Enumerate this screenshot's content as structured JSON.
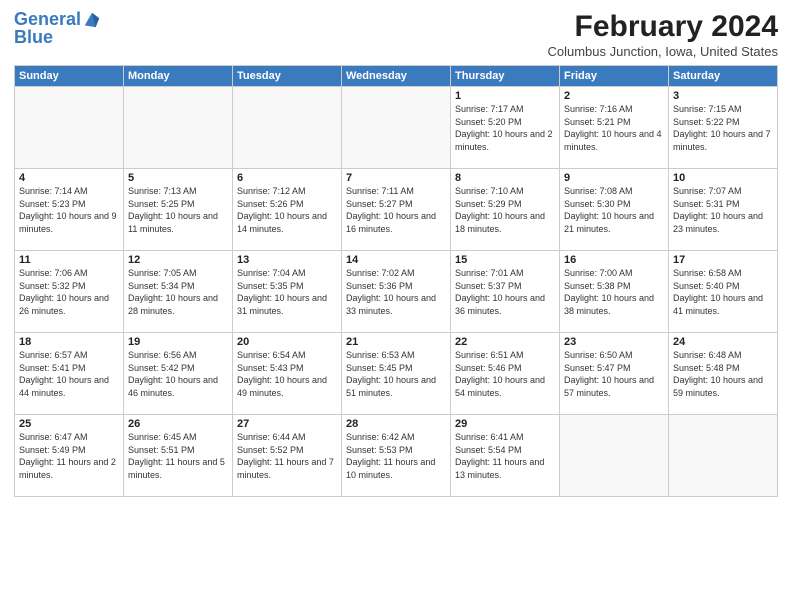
{
  "header": {
    "logo_line1": "General",
    "logo_line2": "Blue",
    "title": "February 2024",
    "subtitle": "Columbus Junction, Iowa, United States"
  },
  "weekdays": [
    "Sunday",
    "Monday",
    "Tuesday",
    "Wednesday",
    "Thursday",
    "Friday",
    "Saturday"
  ],
  "weeks": [
    [
      {
        "day": "",
        "info": ""
      },
      {
        "day": "",
        "info": ""
      },
      {
        "day": "",
        "info": ""
      },
      {
        "day": "",
        "info": ""
      },
      {
        "day": "1",
        "info": "Sunrise: 7:17 AM\nSunset: 5:20 PM\nDaylight: 10 hours\nand 2 minutes."
      },
      {
        "day": "2",
        "info": "Sunrise: 7:16 AM\nSunset: 5:21 PM\nDaylight: 10 hours\nand 4 minutes."
      },
      {
        "day": "3",
        "info": "Sunrise: 7:15 AM\nSunset: 5:22 PM\nDaylight: 10 hours\nand 7 minutes."
      }
    ],
    [
      {
        "day": "4",
        "info": "Sunrise: 7:14 AM\nSunset: 5:23 PM\nDaylight: 10 hours\nand 9 minutes."
      },
      {
        "day": "5",
        "info": "Sunrise: 7:13 AM\nSunset: 5:25 PM\nDaylight: 10 hours\nand 11 minutes."
      },
      {
        "day": "6",
        "info": "Sunrise: 7:12 AM\nSunset: 5:26 PM\nDaylight: 10 hours\nand 14 minutes."
      },
      {
        "day": "7",
        "info": "Sunrise: 7:11 AM\nSunset: 5:27 PM\nDaylight: 10 hours\nand 16 minutes."
      },
      {
        "day": "8",
        "info": "Sunrise: 7:10 AM\nSunset: 5:29 PM\nDaylight: 10 hours\nand 18 minutes."
      },
      {
        "day": "9",
        "info": "Sunrise: 7:08 AM\nSunset: 5:30 PM\nDaylight: 10 hours\nand 21 minutes."
      },
      {
        "day": "10",
        "info": "Sunrise: 7:07 AM\nSunset: 5:31 PM\nDaylight: 10 hours\nand 23 minutes."
      }
    ],
    [
      {
        "day": "11",
        "info": "Sunrise: 7:06 AM\nSunset: 5:32 PM\nDaylight: 10 hours\nand 26 minutes."
      },
      {
        "day": "12",
        "info": "Sunrise: 7:05 AM\nSunset: 5:34 PM\nDaylight: 10 hours\nand 28 minutes."
      },
      {
        "day": "13",
        "info": "Sunrise: 7:04 AM\nSunset: 5:35 PM\nDaylight: 10 hours\nand 31 minutes."
      },
      {
        "day": "14",
        "info": "Sunrise: 7:02 AM\nSunset: 5:36 PM\nDaylight: 10 hours\nand 33 minutes."
      },
      {
        "day": "15",
        "info": "Sunrise: 7:01 AM\nSunset: 5:37 PM\nDaylight: 10 hours\nand 36 minutes."
      },
      {
        "day": "16",
        "info": "Sunrise: 7:00 AM\nSunset: 5:38 PM\nDaylight: 10 hours\nand 38 minutes."
      },
      {
        "day": "17",
        "info": "Sunrise: 6:58 AM\nSunset: 5:40 PM\nDaylight: 10 hours\nand 41 minutes."
      }
    ],
    [
      {
        "day": "18",
        "info": "Sunrise: 6:57 AM\nSunset: 5:41 PM\nDaylight: 10 hours\nand 44 minutes."
      },
      {
        "day": "19",
        "info": "Sunrise: 6:56 AM\nSunset: 5:42 PM\nDaylight: 10 hours\nand 46 minutes."
      },
      {
        "day": "20",
        "info": "Sunrise: 6:54 AM\nSunset: 5:43 PM\nDaylight: 10 hours\nand 49 minutes."
      },
      {
        "day": "21",
        "info": "Sunrise: 6:53 AM\nSunset: 5:45 PM\nDaylight: 10 hours\nand 51 minutes."
      },
      {
        "day": "22",
        "info": "Sunrise: 6:51 AM\nSunset: 5:46 PM\nDaylight: 10 hours\nand 54 minutes."
      },
      {
        "day": "23",
        "info": "Sunrise: 6:50 AM\nSunset: 5:47 PM\nDaylight: 10 hours\nand 57 minutes."
      },
      {
        "day": "24",
        "info": "Sunrise: 6:48 AM\nSunset: 5:48 PM\nDaylight: 10 hours\nand 59 minutes."
      }
    ],
    [
      {
        "day": "25",
        "info": "Sunrise: 6:47 AM\nSunset: 5:49 PM\nDaylight: 11 hours\nand 2 minutes."
      },
      {
        "day": "26",
        "info": "Sunrise: 6:45 AM\nSunset: 5:51 PM\nDaylight: 11 hours\nand 5 minutes."
      },
      {
        "day": "27",
        "info": "Sunrise: 6:44 AM\nSunset: 5:52 PM\nDaylight: 11 hours\nand 7 minutes."
      },
      {
        "day": "28",
        "info": "Sunrise: 6:42 AM\nSunset: 5:53 PM\nDaylight: 11 hours\nand 10 minutes."
      },
      {
        "day": "29",
        "info": "Sunrise: 6:41 AM\nSunset: 5:54 PM\nDaylight: 11 hours\nand 13 minutes."
      },
      {
        "day": "",
        "info": ""
      },
      {
        "day": "",
        "info": ""
      }
    ]
  ]
}
